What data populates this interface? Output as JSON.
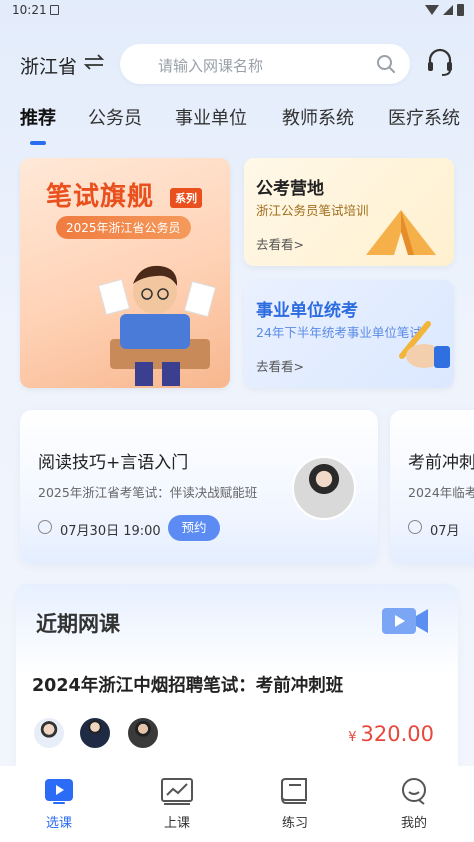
{
  "status_bar": {
    "time": "10:21"
  },
  "header": {
    "province": "浙江省",
    "search_placeholder": "请输入网课名称"
  },
  "tabs": [
    {
      "label": "推荐",
      "active": true
    },
    {
      "label": "公务员"
    },
    {
      "label": "事业单位"
    },
    {
      "label": "教师系统"
    },
    {
      "label": "医疗系统"
    }
  ],
  "banners": {
    "main": {
      "title": "笔试旗舰",
      "series_badge": "系列",
      "subtitle": "2025年浙江省公务员"
    },
    "camp": {
      "title": "公考营地",
      "desc": "浙江公务员笔试培训",
      "link": "去看看>"
    },
    "unit": {
      "title": "事业单位统考",
      "desc": "24年下半年统考事业单位笔试",
      "link": "去看看>"
    }
  },
  "live_courses": [
    {
      "title": "阅读技巧+言语入门",
      "subtitle": "2025年浙江省考笔试：伴读决战赋能班",
      "time": "07月30日 19:00",
      "action": "预约"
    },
    {
      "title": "考前冲刺",
      "subtitle": "2024年临考",
      "time": "07月"
    }
  ],
  "recent": {
    "heading": "近期网课",
    "course_title": "2024年浙江中烟招聘笔试：考前冲刺班",
    "currency": "¥",
    "price": "320.00"
  },
  "bottom_nav": [
    {
      "label": "选课",
      "icon": "play-icon",
      "active": true
    },
    {
      "label": "上课",
      "icon": "chart-board-icon"
    },
    {
      "label": "练习",
      "icon": "notebook-icon"
    },
    {
      "label": "我的",
      "icon": "profile-chat-icon"
    }
  ],
  "colors": {
    "accent": "#2b6cf6",
    "price": "#e8473b",
    "banner_orange": "#e9501d"
  }
}
